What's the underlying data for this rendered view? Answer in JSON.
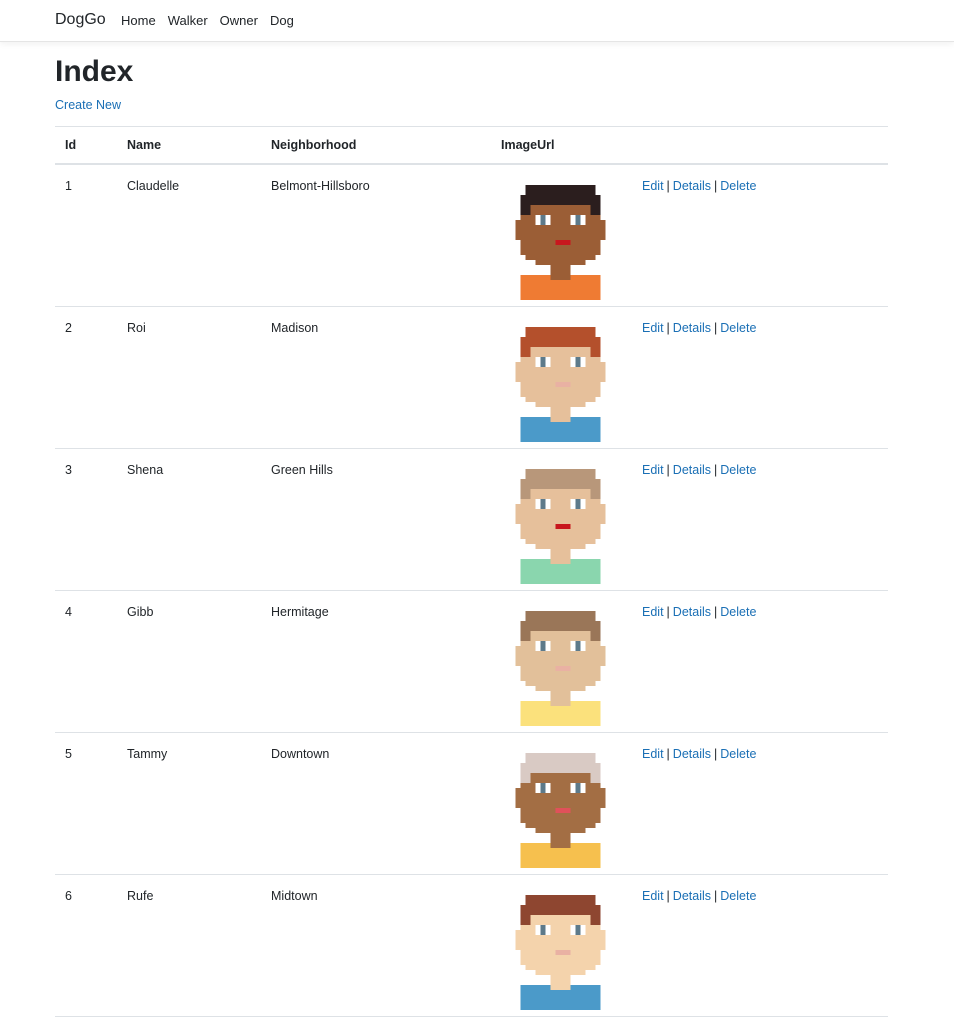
{
  "navbar": {
    "brand": "DogGo",
    "links": [
      "Home",
      "Walker",
      "Owner",
      "Dog"
    ]
  },
  "page": {
    "title": "Index",
    "create_link": "Create New"
  },
  "table": {
    "headers": [
      "Id",
      "Name",
      "Neighborhood",
      "ImageUrl",
      ""
    ],
    "action_labels": {
      "edit": "Edit",
      "details": "Details",
      "delete": "Delete",
      "separator": "|"
    },
    "rows": [
      {
        "id": "1",
        "name": "Claudelle",
        "neighborhood": "Belmont-Hillsboro",
        "avatar": "avatar-1-icon"
      },
      {
        "id": "2",
        "name": "Roi",
        "neighborhood": "Madison",
        "avatar": "avatar-2-icon"
      },
      {
        "id": "3",
        "name": "Shena",
        "neighborhood": "Green Hills",
        "avatar": "avatar-3-icon"
      },
      {
        "id": "4",
        "name": "Gibb",
        "neighborhood": "Hermitage",
        "avatar": "avatar-4-icon"
      },
      {
        "id": "5",
        "name": "Tammy",
        "neighborhood": "Downtown",
        "avatar": "avatar-5-icon"
      },
      {
        "id": "6",
        "name": "Rufe",
        "neighborhood": "Midtown",
        "avatar": "avatar-6-icon"
      }
    ]
  },
  "colors": {
    "link": "#1a6fb5",
    "text": "#212529",
    "border": "#dee2e6"
  }
}
